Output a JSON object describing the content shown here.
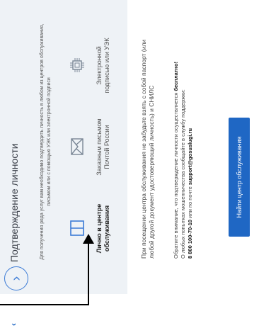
{
  "header": {
    "title": "Подтверждение личности"
  },
  "intro": "Для получения ряда услуг вам необходимо подтвердить личность в любом из центров обслуживания, письмом или с помощью УЭК или электронной подписи",
  "methods": [
    {
      "label": "Лично в центре обслуживания",
      "icon": "book-icon",
      "active": true
    },
    {
      "label": "Заказным письмом Почтой России",
      "icon": "envelope-icon",
      "active": false
    },
    {
      "label": "Электронной подписью или УЭК",
      "icon": "chip-icon",
      "active": false
    }
  ],
  "note": "При посещении центра обслуживания не забудьте взять с собой паспорт (или любой другой документ удостоверяющий личность) и СНИЛС",
  "free": {
    "line1_prefix": "Обратите внимание, что подтверждение личности осуществляется ",
    "line1_bold": "бесплатно!",
    "line2": "О любых попытках мошенничества сообщайте в службу поддержки:",
    "phone": "8 800 100-70-10",
    "or": " или по почте ",
    "email": "support@gosuslugi.ru"
  },
  "button": {
    "label": "Найти центр обслуживания"
  },
  "colors": {
    "accent": "#1f67c4",
    "panel_bg": "#eef2f6"
  }
}
